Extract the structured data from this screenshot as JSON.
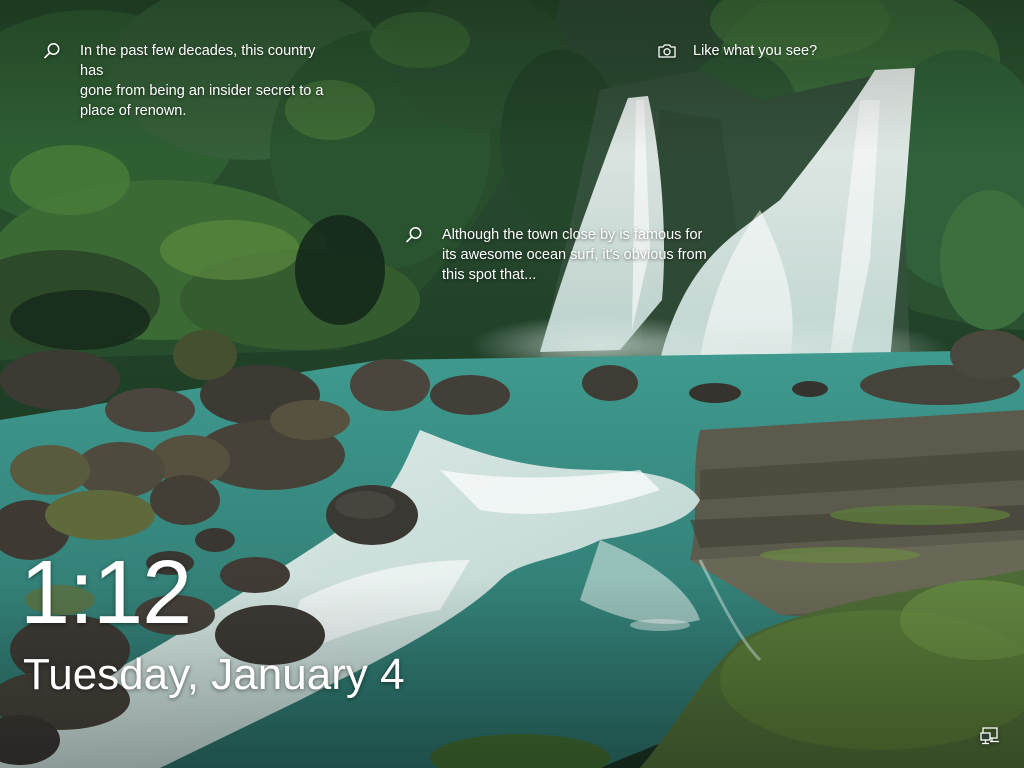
{
  "lockscreen": {
    "clock": "1:12",
    "date": "Tuesday, January 4",
    "hints": [
      {
        "icon": "search-icon",
        "text": "In the past few decades, this country has\ngone from being an insider secret to a\nplace of renown."
      },
      {
        "icon": "search-icon",
        "text": "Although the town close by is famous for\nits awesome ocean surf, it's obvious from\nthis spot that..."
      },
      {
        "icon": "camera-icon",
        "text": "Like what you see?"
      }
    ],
    "status_icons": [
      "network-icon"
    ]
  },
  "colors": {
    "text": "#ffffff",
    "water": "#3e8c80",
    "foliage": "#24502e"
  }
}
